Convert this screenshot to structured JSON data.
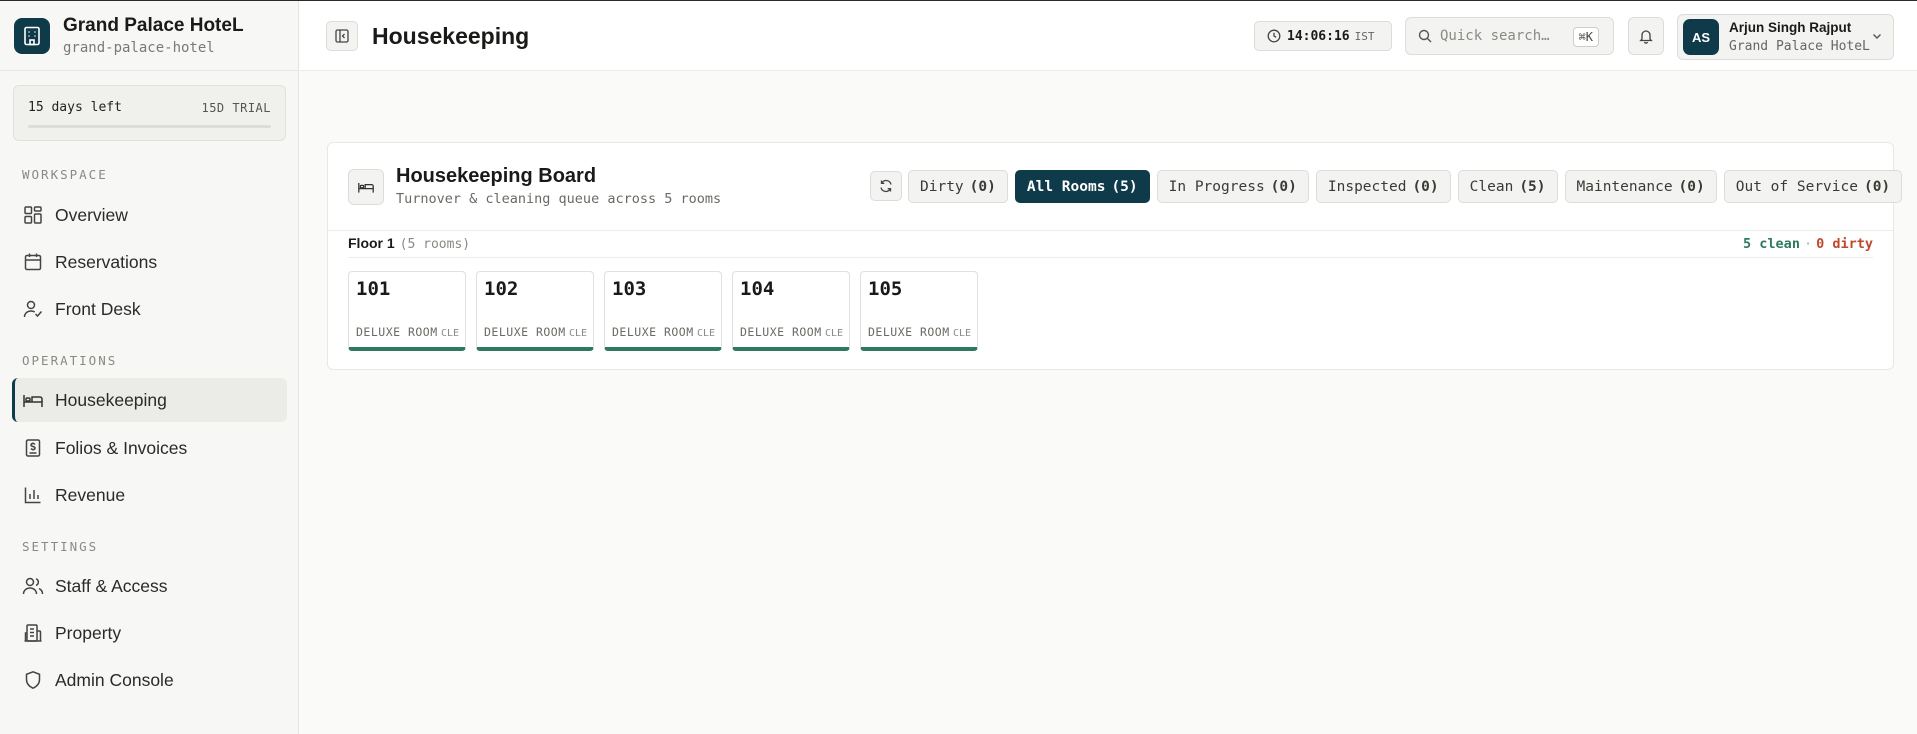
{
  "brand": {
    "name": "Grand Palace HoteL",
    "slug": "grand-palace-hotel"
  },
  "trial": {
    "left_text": "15 days left",
    "badge": "15D TRIAL",
    "progress": 0
  },
  "sidebar": {
    "sections": [
      {
        "label": "WORKSPACE",
        "items": [
          {
            "label": "Overview",
            "icon": "grid-icon"
          },
          {
            "label": "Reservations",
            "icon": "calendar-icon"
          },
          {
            "label": "Front Desk",
            "icon": "user-check-icon"
          }
        ]
      },
      {
        "label": "OPERATIONS",
        "items": [
          {
            "label": "Housekeeping",
            "icon": "bed-icon",
            "active": true
          },
          {
            "label": "Folios & Invoices",
            "icon": "receipt-icon"
          },
          {
            "label": "Revenue",
            "icon": "bar-chart-icon"
          }
        ]
      },
      {
        "label": "SETTINGS",
        "items": [
          {
            "label": "Staff & Access",
            "icon": "users-icon"
          },
          {
            "label": "Property",
            "icon": "building-icon"
          },
          {
            "label": "Admin Console",
            "icon": "shield-icon"
          }
        ]
      }
    ]
  },
  "header": {
    "title": "Housekeeping",
    "clock_time": "14:06:16",
    "clock_zone": "IST",
    "search_placeholder": "Quick search…",
    "search_shortcut": "⌘K",
    "user_initials": "AS",
    "user_name": "Arjun Singh Rajput",
    "user_property": "Grand Palace HoteL"
  },
  "board": {
    "title": "Housekeeping Board",
    "subtitle": "Turnover & cleaning queue across 5 rooms",
    "filters": [
      {
        "label": "Dirty",
        "count": "(0)"
      },
      {
        "label": "All Rooms",
        "count": "(5)",
        "active": true
      },
      {
        "label": "In Progress",
        "count": "(0)"
      },
      {
        "label": "Inspected",
        "count": "(0)"
      },
      {
        "label": "Clean",
        "count": "(5)"
      },
      {
        "label": "Maintenance",
        "count": "(0)"
      },
      {
        "label": "Out of Service",
        "count": "(0)"
      }
    ],
    "floor": {
      "name": "Floor 1",
      "count": "(5 rooms)",
      "clean_stat": "5 clean",
      "separator": "·",
      "dirty_stat": "0 dirty"
    },
    "rooms": [
      {
        "number": "101",
        "type": "DELUXE ROOM",
        "status": "CLE"
      },
      {
        "number": "102",
        "type": "DELUXE ROOM",
        "status": "CLE"
      },
      {
        "number": "103",
        "type": "DELUXE ROOM",
        "status": "CLE"
      },
      {
        "number": "104",
        "type": "DELUXE ROOM",
        "status": "CLE"
      },
      {
        "number": "105",
        "type": "DELUXE ROOM",
        "status": "CLE"
      }
    ]
  },
  "colors": {
    "brand": "#0f3a4a",
    "clean": "#2e7a5e",
    "dirty": "#c0492b"
  }
}
